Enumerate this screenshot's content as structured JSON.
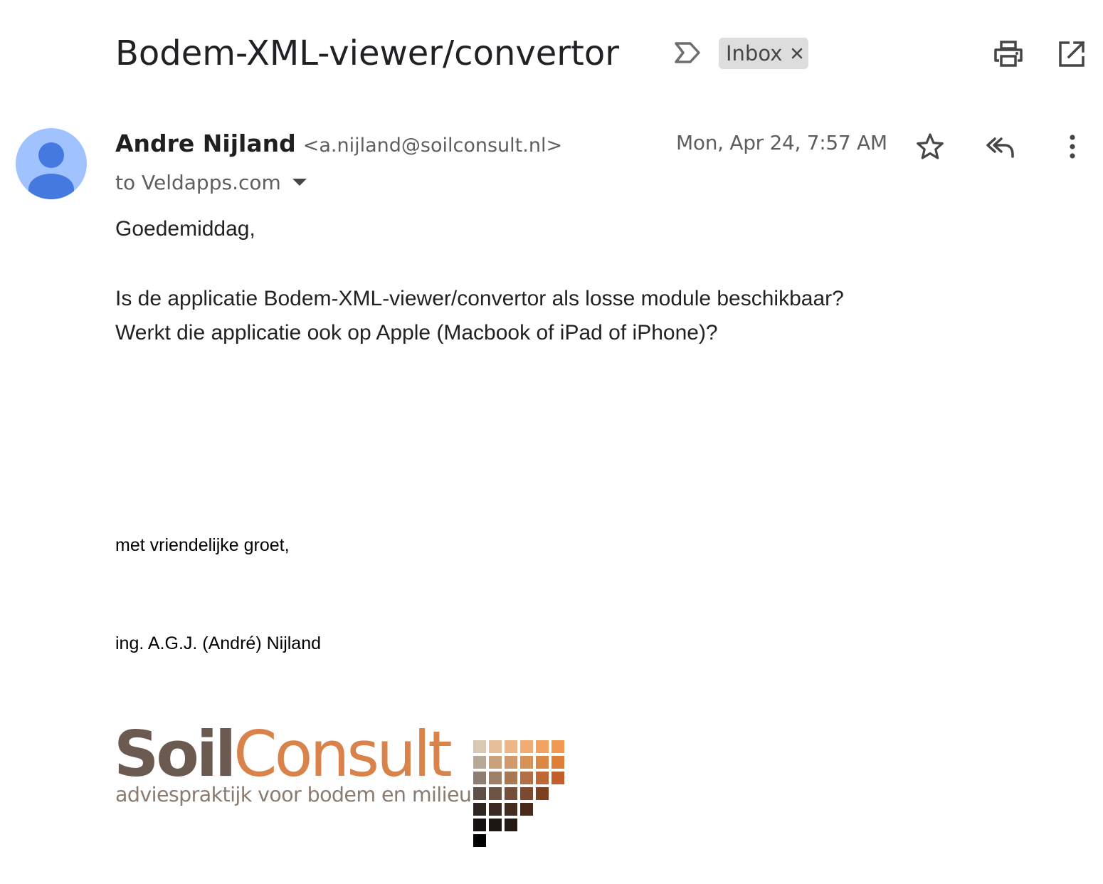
{
  "email": {
    "subject": "Bodem-XML-viewer/convertor",
    "label_chip": "Inbox",
    "sender_name": "Andre Nijland",
    "sender_email": "<a.nijland@soilconsult.nl>",
    "date": "Mon, Apr 24, 7:57 AM",
    "recipient": "to Veldapps.com",
    "body": {
      "greeting": "Goedemiddag,",
      "line1": "Is de applicatie Bodem-XML-viewer/convertor als losse module beschikbaar?",
      "line2": "Werkt die applicatie ook op Apple (Macbook of iPad of iPhone)?"
    },
    "signature": {
      "closing": "met vriendelijke groet,",
      "name": "ing. A.G.J. (André) Nijland",
      "logo_word1": "Soil",
      "logo_word2": "Consult",
      "logo_tagline": "adviespraktijk voor bodem en milieu"
    }
  },
  "icons": {
    "importance": "importance-marker-icon",
    "chip_close": "close-icon",
    "print": "print-icon",
    "new_window": "open-in-new-window-icon",
    "avatar": "person-icon",
    "star": "star-icon",
    "reply_all": "reply-all-icon",
    "more": "more-vertical-icon",
    "recipient_caret": "caret-down-icon"
  },
  "colors": {
    "avatar_bg": "#a0c3ff",
    "avatar_fg": "#4479e0",
    "chip_bg": "#dddddd",
    "logo_soil": "#6b5a50",
    "logo_consult": "#d9834a",
    "logo_tagline": "#8a7a70"
  }
}
